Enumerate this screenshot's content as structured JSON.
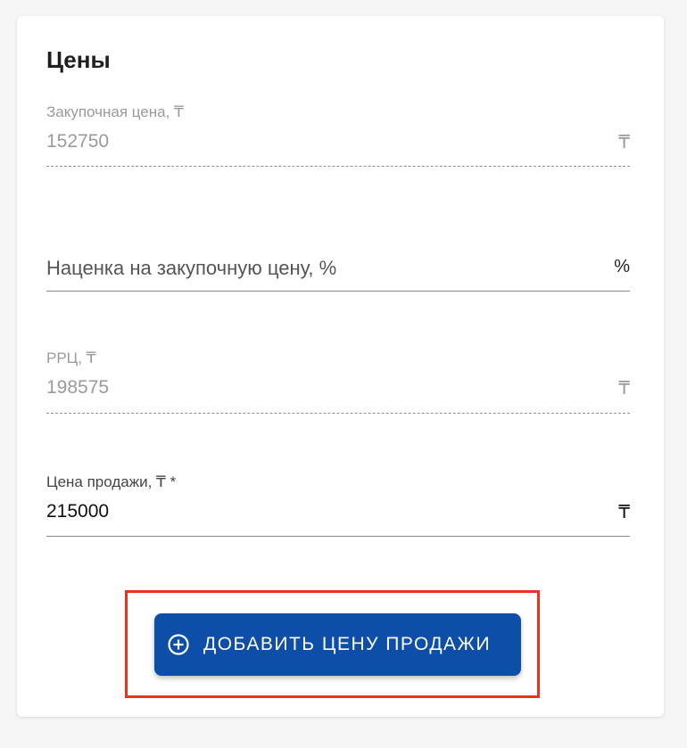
{
  "section": {
    "title": "Цены"
  },
  "fields": {
    "purchase_price": {
      "label": "Закупочная цена, ₸",
      "value": "152750",
      "suffix": "₸"
    },
    "markup": {
      "placeholder": "Наценка на закупочную цену, %",
      "suffix": "%"
    },
    "rrp": {
      "label": "РРЦ, ₸",
      "value": "198575",
      "suffix": "₸"
    },
    "sale_price": {
      "label": "Цена продажи, ₸ *",
      "value": "215000",
      "suffix": "₸"
    }
  },
  "actions": {
    "add_sale_price_label": "ДОБАВИТЬ ЦЕНУ ПРОДАЖИ",
    "add_icon": "plus-circle-icon"
  },
  "colors": {
    "button_bg": "#0d4ea8",
    "highlight_border": "#e8341c"
  }
}
